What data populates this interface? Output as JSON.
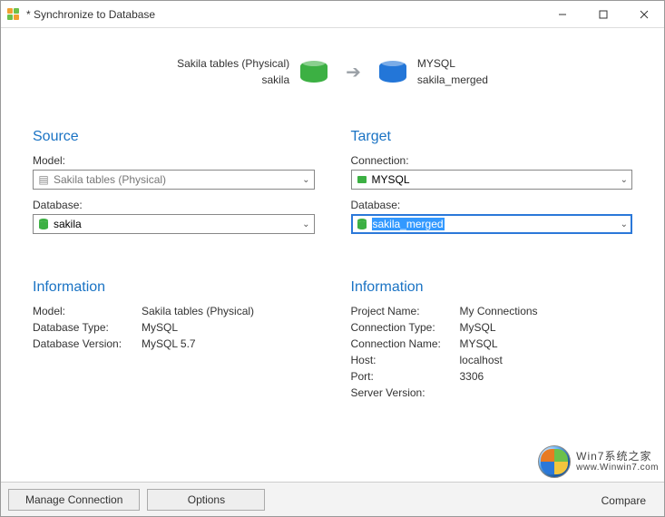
{
  "window": {
    "title": "* Synchronize to Database"
  },
  "header": {
    "left_line1": "Sakila tables (Physical)",
    "left_line2": "sakila",
    "right_line1": "MYSQL",
    "right_line2": "sakila_merged"
  },
  "source": {
    "title": "Source",
    "model_label": "Model:",
    "model_value": "Sakila tables (Physical)",
    "database_label": "Database:",
    "database_value": "sakila"
  },
  "target": {
    "title": "Target",
    "connection_label": "Connection:",
    "connection_value": "MYSQL",
    "database_label": "Database:",
    "database_value": "sakila_merged"
  },
  "source_info": {
    "title": "Information",
    "keys": {
      "model": "Model:",
      "db_type": "Database Type:",
      "db_version": "Database Version:"
    },
    "vals": {
      "model": "Sakila tables (Physical)",
      "db_type": "MySQL",
      "db_version": "MySQL 5.7"
    }
  },
  "target_info": {
    "title": "Information",
    "keys": {
      "project": "Project Name:",
      "conn_type": "Connection Type:",
      "conn_name": "Connection Name:",
      "host": "Host:",
      "port": "Port:",
      "server": "Server Version:"
    },
    "vals": {
      "project": "My Connections",
      "conn_type": "MySQL",
      "conn_name": "MYSQL",
      "host": "localhost",
      "port": "3306",
      "server": ""
    }
  },
  "footer": {
    "manage": "Manage Connection",
    "options": "Options",
    "compare": "Compare"
  },
  "watermark": {
    "line1": "Win7系统之家",
    "line2": "www.Winwin7.com"
  }
}
